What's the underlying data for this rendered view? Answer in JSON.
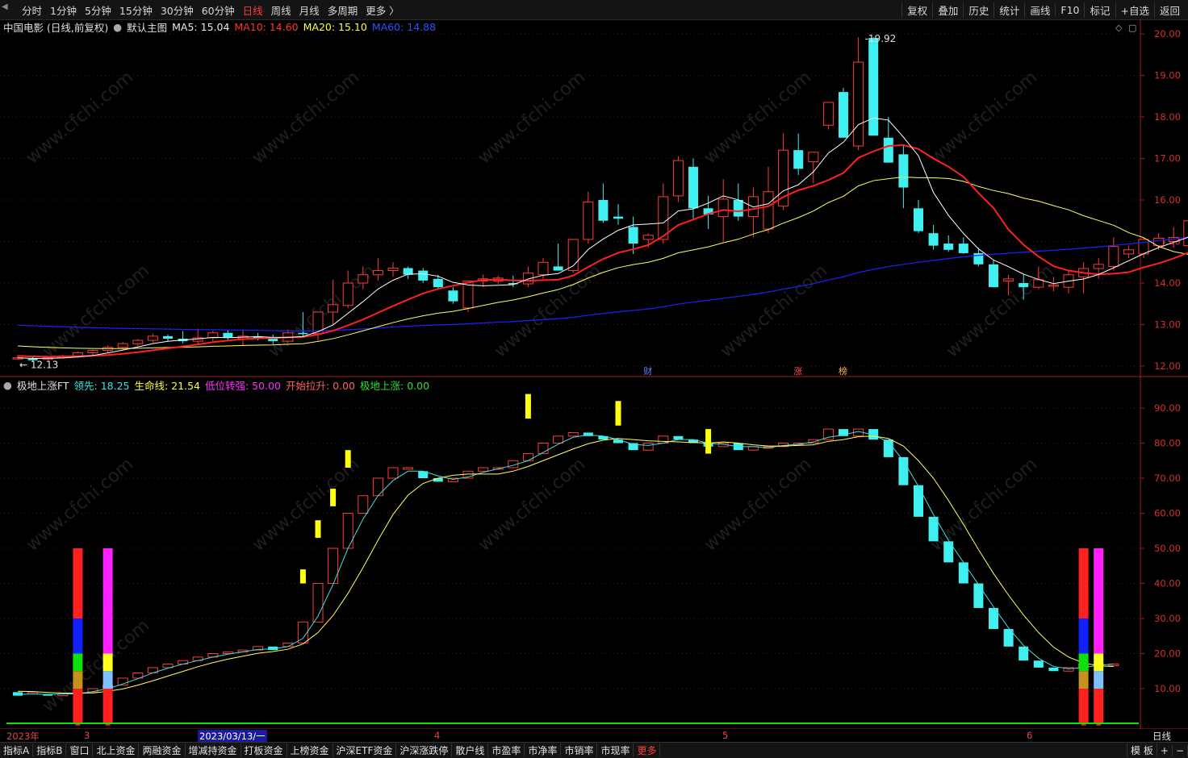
{
  "topbar": {
    "timeframes": [
      "分时",
      "1分钟",
      "5分钟",
      "15分钟",
      "30分钟",
      "60分钟",
      "日线",
      "周线",
      "月线",
      "多周期",
      "更多 〉"
    ],
    "active_timeframe": "日线",
    "right_buttons": [
      "复权",
      "叠加",
      "历史",
      "统计",
      "画线",
      "F10",
      "标记",
      "+自选",
      "返回"
    ]
  },
  "main_legend": {
    "stock": "中国电影 (日线,前复权)",
    "template": "默认主图",
    "ma5": "MA5: 15.04",
    "ma10": "MA10: 14.60",
    "ma20": "MA20: 15.10",
    "ma60": "MA60: 14.88"
  },
  "sub_legend": {
    "indicator": "极地上涨FT",
    "lead": "领先: 18.25",
    "life": "生命线: 21.54",
    "low_turn": "低位转强: 50.00",
    "start": "开始拉升: 0.00",
    "surge": "极地上涨: 0.00"
  },
  "markers": {
    "high": "19.92",
    "low": "← 12.13",
    "cai": "财",
    "zhang": "涨",
    "bang": "榜"
  },
  "date_axis": {
    "year": "2023年",
    "m3": "3",
    "cursor": "2023/03/13/一",
    "m4": "4",
    "m5": "5",
    "m6": "6",
    "period": "日线"
  },
  "bottombar": {
    "items": [
      "指标A",
      "指标B",
      "窗口",
      "北上资金",
      "两融资金",
      "增减持资金",
      "打板资金",
      "上榜资金",
      "沪深ETF资金",
      "沪深涨跌停",
      "散户线",
      "市盈率",
      "市净率",
      "市销率",
      "市现率",
      "更多"
    ],
    "right_items": [
      "模 板",
      "+",
      "−"
    ]
  },
  "colors": {
    "up": "#ff3b3b",
    "down": "#40f0f0",
    "ma5": "#ffffff",
    "ma10": "#ff2020",
    "ma20": "#ffff60",
    "ma60": "#2020ff"
  },
  "chart_data": [
    {
      "type": "candlestick",
      "title": "中国电影 (日线,前复权)",
      "yaxis_labels": [
        "20.00",
        "19.00",
        "18.00",
        "17.00",
        "16.00",
        "15.00",
        "14.00",
        "13.00",
        "12.00"
      ],
      "ylim": [
        11.85,
        20.2
      ],
      "candles": [
        [
          12.2,
          12.26,
          12.15,
          12.2
        ],
        [
          12.18,
          12.22,
          12.1,
          12.14
        ],
        [
          12.16,
          12.22,
          12.13,
          12.2
        ],
        [
          12.2,
          12.28,
          12.18,
          12.24
        ],
        [
          12.25,
          12.35,
          12.2,
          12.32
        ],
        [
          12.32,
          12.4,
          12.25,
          12.38
        ],
        [
          12.38,
          12.5,
          12.32,
          12.45
        ],
        [
          12.45,
          12.58,
          12.4,
          12.54
        ],
        [
          12.54,
          12.65,
          12.48,
          12.62
        ],
        [
          12.62,
          12.78,
          12.56,
          12.72
        ],
        [
          12.72,
          12.76,
          12.6,
          12.66
        ],
        [
          12.66,
          12.84,
          12.55,
          12.6
        ],
        [
          12.6,
          12.9,
          12.5,
          12.68
        ],
        [
          12.68,
          12.85,
          12.6,
          12.8
        ],
        [
          12.8,
          12.88,
          12.62,
          12.68
        ],
        [
          12.66,
          12.86,
          12.5,
          12.72
        ],
        [
          12.72,
          12.8,
          12.62,
          12.66
        ],
        [
          12.66,
          12.76,
          12.52,
          12.6
        ],
        [
          12.6,
          12.88,
          12.56,
          12.8
        ],
        [
          12.8,
          13.3,
          12.7,
          12.78
        ],
        [
          12.78,
          13.28,
          12.62,
          13.3
        ],
        [
          13.3,
          14.08,
          13.0,
          13.48
        ],
        [
          13.46,
          14.3,
          13.4,
          14.0
        ],
        [
          14.0,
          14.4,
          13.85,
          14.2
        ],
        [
          14.2,
          14.6,
          14.05,
          14.3
        ],
        [
          14.3,
          14.5,
          14.15,
          14.36
        ],
        [
          14.36,
          14.4,
          14.1,
          14.2
        ],
        [
          14.3,
          14.36,
          14.0,
          14.06
        ],
        [
          14.1,
          14.2,
          13.85,
          13.9
        ],
        [
          13.82,
          13.9,
          13.5,
          13.56
        ],
        [
          13.4,
          14.05,
          13.3,
          14.05
        ],
        [
          14.05,
          14.2,
          13.9,
          14.1
        ],
        [
          14.05,
          14.18,
          13.98,
          14.12
        ],
        [
          14.0,
          14.18,
          13.9,
          13.98
        ],
        [
          13.98,
          14.4,
          13.9,
          14.24
        ],
        [
          14.2,
          14.6,
          14.1,
          14.5
        ],
        [
          14.4,
          14.95,
          14.3,
          14.3
        ],
        [
          14.3,
          15.05,
          14.25,
          15.05
        ],
        [
          15.05,
          16.2,
          14.95,
          15.95
        ],
        [
          16.0,
          16.4,
          15.45,
          15.5
        ],
        [
          15.6,
          15.9,
          15.4,
          15.55
        ],
        [
          15.35,
          15.6,
          14.7,
          14.95
        ],
        [
          15.05,
          15.2,
          14.85,
          15.15
        ],
        [
          15.05,
          16.4,
          14.95,
          16.08
        ],
        [
          16.1,
          17.05,
          15.95,
          16.95
        ],
        [
          16.8,
          17.0,
          15.55,
          15.8
        ],
        [
          15.8,
          16.1,
          15.3,
          15.65
        ],
        [
          15.6,
          16.5,
          15.0,
          16.02
        ],
        [
          16.0,
          16.4,
          15.5,
          15.6
        ],
        [
          15.6,
          16.3,
          15.1,
          16.08
        ],
        [
          15.3,
          16.8,
          15.2,
          16.2
        ],
        [
          15.85,
          17.6,
          15.75,
          17.2
        ],
        [
          17.2,
          17.6,
          16.6,
          16.75
        ],
        [
          16.92,
          17.1,
          16.4,
          17.15
        ],
        [
          17.8,
          18.1,
          17.7,
          18.35
        ],
        [
          18.6,
          18.7,
          17.5,
          17.5
        ],
        [
          17.3,
          19.92,
          17.2,
          19.32
        ],
        [
          19.9,
          19.92,
          18.3,
          17.55
        ],
        [
          17.5,
          18.0,
          16.9,
          16.9
        ],
        [
          17.1,
          17.3,
          15.8,
          16.3
        ],
        [
          15.8,
          16.0,
          15.2,
          15.25
        ],
        [
          15.2,
          15.4,
          14.8,
          14.9
        ],
        [
          14.95,
          15.15,
          14.75,
          14.8
        ],
        [
          14.95,
          15.1,
          14.7,
          14.72
        ],
        [
          14.72,
          14.85,
          14.4,
          14.45
        ],
        [
          14.45,
          14.55,
          13.9,
          13.9
        ],
        [
          14.05,
          14.2,
          13.7,
          14.1
        ],
        [
          14.0,
          14.2,
          13.6,
          13.9
        ],
        [
          13.9,
          14.4,
          13.85,
          14.08
        ],
        [
          13.95,
          14.15,
          13.8,
          13.95
        ],
        [
          13.9,
          14.3,
          13.75,
          14.2
        ],
        [
          14.15,
          14.5,
          13.75,
          14.35
        ],
        [
          14.35,
          14.6,
          14.1,
          14.45
        ],
        [
          14.4,
          15.1,
          14.3,
          14.88
        ],
        [
          14.7,
          14.9,
          14.6,
          14.8
        ],
        [
          14.7,
          15.1,
          14.6,
          15.05
        ],
        [
          14.9,
          15.2,
          14.8,
          15.08
        ],
        [
          15.0,
          15.35,
          14.85,
          15.1
        ],
        [
          14.9,
          15.7,
          14.65,
          15.5
        ]
      ]
    },
    {
      "type": "bar",
      "title": "极地上涨FT",
      "yaxis_labels": [
        "90.00",
        "80.00",
        "70.00",
        "60.00",
        "50.00",
        "40.00",
        "30.00",
        "20.00",
        "10.00"
      ],
      "ylim": [
        0,
        97
      ],
      "columns": [
        [
          9,
          8
        ],
        [
          8.5,
          9
        ],
        [
          8.5,
          8
        ],
        [
          8,
          8.5
        ],
        [
          8.5,
          9
        ],
        [
          9,
          10
        ],
        [
          10,
          11
        ],
        [
          11,
          13
        ],
        [
          13,
          14.5
        ],
        [
          14.5,
          16
        ],
        [
          16,
          17
        ],
        [
          17,
          18
        ],
        [
          18,
          19
        ],
        [
          19,
          20
        ],
        [
          20,
          20.5
        ],
        [
          20.5,
          21
        ],
        [
          21,
          22
        ],
        [
          22,
          21
        ],
        [
          22,
          23
        ],
        [
          23,
          29
        ],
        [
          29,
          40
        ],
        [
          40,
          50
        ],
        [
          50,
          60
        ],
        [
          60,
          65
        ],
        [
          65,
          70
        ],
        [
          70,
          73
        ],
        [
          73,
          73
        ],
        [
          72,
          70
        ],
        [
          70,
          69
        ],
        [
          69,
          70
        ],
        [
          70,
          72
        ],
        [
          72,
          73
        ],
        [
          73,
          73
        ],
        [
          73,
          75
        ],
        [
          75,
          77
        ],
        [
          77,
          80
        ],
        [
          80,
          82
        ],
        [
          82,
          83
        ],
        [
          83,
          82
        ],
        [
          82,
          81
        ],
        [
          81,
          80
        ],
        [
          80,
          78
        ],
        [
          78,
          80
        ],
        [
          80,
          82
        ],
        [
          82,
          81
        ],
        [
          81,
          80
        ],
        [
          80,
          79
        ],
        [
          79,
          80
        ],
        [
          80,
          78
        ],
        [
          78,
          79
        ],
        [
          79,
          79
        ],
        [
          79,
          80
        ],
        [
          80,
          80
        ],
        [
          80,
          81
        ],
        [
          81,
          84
        ],
        [
          84,
          82
        ],
        [
          82,
          84
        ],
        [
          84,
          81
        ],
        [
          81,
          76
        ],
        [
          76,
          68
        ],
        [
          68,
          59
        ],
        [
          59,
          52
        ],
        [
          52,
          46
        ],
        [
          46,
          40
        ],
        [
          40,
          33
        ],
        [
          33,
          27
        ],
        [
          27,
          22
        ],
        [
          22,
          18
        ],
        [
          18,
          16
        ],
        [
          16,
          15
        ],
        [
          15,
          16
        ],
        [
          16,
          17
        ],
        [
          17,
          17
        ],
        [
          17,
          17
        ]
      ],
      "yellow_bars": [
        [
          19,
          40,
          44
        ],
        [
          20,
          53,
          58
        ],
        [
          21,
          62,
          67
        ],
        [
          22,
          73,
          78
        ],
        [
          34,
          87,
          94
        ],
        [
          40,
          85,
          92
        ],
        [
          46,
          77,
          84
        ]
      ],
      "signals": [
        {
          "index": 4,
          "segments": [
            [
              0,
              10,
              "#ff2020"
            ],
            [
              10,
              15,
              "#c89020"
            ],
            [
              15,
              20,
              "#10e010"
            ],
            [
              20,
              30,
              "#1020ff"
            ],
            [
              30,
              50,
              "#ff2020"
            ]
          ]
        },
        {
          "index": 6,
          "segments": [
            [
              0,
              10,
              "#ff2020"
            ],
            [
              10,
              15,
              "#80c0ff"
            ],
            [
              15,
              20,
              "#ffff20"
            ],
            [
              20,
              50,
              "#ff20ff"
            ]
          ]
        },
        {
          "index": 71,
          "segments": [
            [
              0,
              10,
              "#ff2020"
            ],
            [
              10,
              15,
              "#c89020"
            ],
            [
              15,
              20,
              "#10e010"
            ],
            [
              20,
              30,
              "#1020ff"
            ],
            [
              30,
              50,
              "#ff2020"
            ]
          ]
        },
        {
          "index": 72,
          "segments": [
            [
              0,
              10,
              "#ff2020"
            ],
            [
              10,
              15,
              "#80c0ff"
            ],
            [
              15,
              20,
              "#ffff20"
            ],
            [
              20,
              50,
              "#ff20ff"
            ]
          ]
        }
      ]
    }
  ]
}
